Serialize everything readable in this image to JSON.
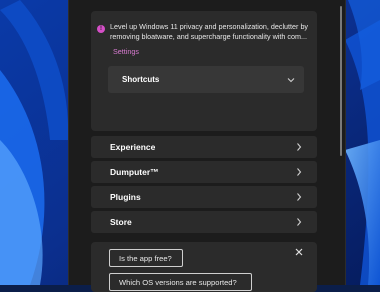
{
  "app": {
    "info_text": "Level up Windows 11 privacy and personalization, declutter by removing bloatware, and supercharge functionality with com...",
    "settings_label": "Settings",
    "shortcuts_label": "Shortcuts",
    "nav_items": [
      {
        "label": "Experience"
      },
      {
        "label": "Dumputer™"
      },
      {
        "label": "Plugins"
      },
      {
        "label": "Store"
      }
    ],
    "faq": {
      "q1": "Is the app free?",
      "q2": "Which OS versions are supported?"
    }
  },
  "colors": {
    "accent": "#d77bd0",
    "window_bg": "#1c1c1c",
    "card_bg": "#2b2b2b"
  },
  "icons": {
    "info": "info-icon",
    "chevron_down": "chevron-down-icon",
    "chevron_right": "chevron-right-icon",
    "close": "close-icon"
  }
}
